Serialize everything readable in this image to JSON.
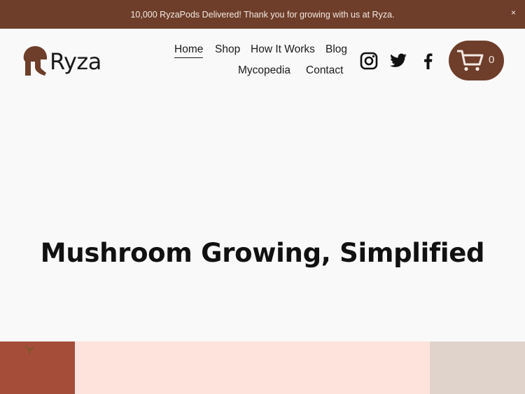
{
  "announcement": {
    "text": "10,000 RyzaPods Delivered! Thank you for growing with us at Ryza.",
    "close_label": "×"
  },
  "brand": {
    "name": "Ryza",
    "logo_icon": "mushroom-icon",
    "color_primary": "#6e3e2a"
  },
  "nav": {
    "items": [
      {
        "label": "Home",
        "active": true
      },
      {
        "label": "Shop"
      },
      {
        "label": "How It Works"
      },
      {
        "label": "Blog"
      },
      {
        "label": "Mycopedia"
      },
      {
        "label": "Contact"
      }
    ]
  },
  "social": [
    "instagram-icon",
    "twitter-icon",
    "facebook-icon"
  ],
  "cart": {
    "icon": "cart-icon",
    "count": "0"
  },
  "hero": {
    "title": "Mushroom Growing, Simplified"
  },
  "strip_colors": [
    "#a54d39",
    "#fde3db",
    "#e0d3cb"
  ]
}
